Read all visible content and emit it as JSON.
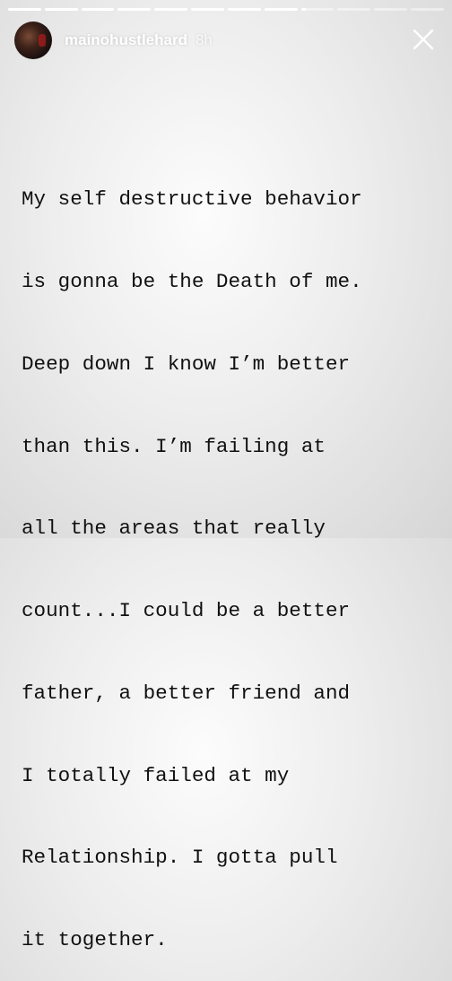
{
  "story": {
    "username": "mainohustlehard",
    "timestamp": "8h",
    "progress": {
      "segments_total": 12,
      "current_index": 8,
      "current_progress": 0.15
    },
    "text_lines": [
      "My self destructive behavior",
      "is gonna be the Death of me.",
      "Deep down I know I’m better",
      "than this. I’m failing at",
      "all the areas that really",
      "count...I could be a better",
      "father, a better friend and",
      "I totally failed at my",
      "Relationship. I gotta pull",
      "it together."
    ]
  },
  "icons": {
    "close": "close-icon",
    "avatar": "avatar"
  },
  "colors": {
    "text": "#111111",
    "overlay_text": "#ffffff",
    "background": "#ececec"
  }
}
